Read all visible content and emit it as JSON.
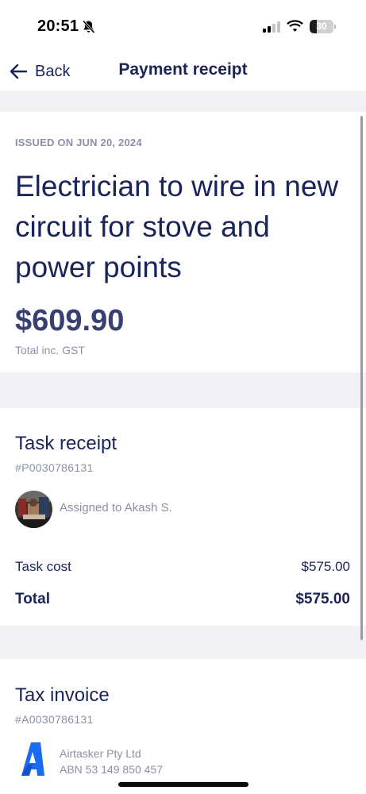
{
  "status_bar": {
    "time": "20:51",
    "battery_level": "30",
    "battery_fraction": 0.3,
    "icons": [
      "bell-slash-icon",
      "cellular-signal-icon",
      "wifi-icon",
      "battery-icon"
    ]
  },
  "nav": {
    "back_label": "Back",
    "title": "Payment receipt"
  },
  "summary": {
    "issued": "ISSUED ON JUN 20, 2024",
    "task_title": "Electrician to wire in new circuit for stove and power points",
    "amount": "$609.90",
    "amount_note": "Total inc. GST"
  },
  "task_receipt": {
    "heading": "Task receipt",
    "id": "#P0030786131",
    "assigned": "Assigned to Akash S.",
    "rows": [
      {
        "label": "Task cost",
        "value": "$575.00"
      },
      {
        "label": "Total",
        "value": "$575.00"
      }
    ]
  },
  "tax_invoice": {
    "heading": "Tax invoice",
    "id": "#A0030786131",
    "logo_letter": "A",
    "company_name": "Airtasker Pty Ltd",
    "abn": "ABN 53 149 850 457"
  },
  "colors": {
    "primary_text": "#1b2458",
    "secondary_text": "#8c90a6",
    "amount": "#383f73",
    "section_gap": "#f2f2f5",
    "logo_blue": "#1b6bf2"
  }
}
